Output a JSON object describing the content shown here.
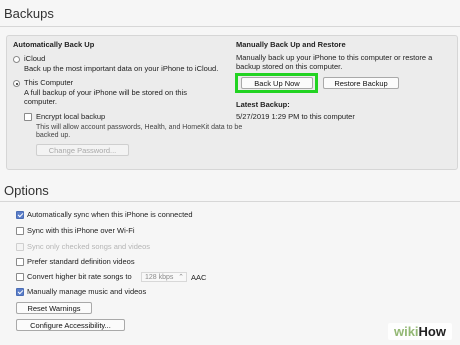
{
  "backups": {
    "title": "Backups",
    "auto": {
      "heading": "Automatically Back Up",
      "icloud_label": "iCloud",
      "icloud_desc": "Back up the most important data on your iPhone to iCloud.",
      "computer_label": "This Computer",
      "computer_desc_1": "A full backup of your iPhone will be stored on this",
      "computer_desc_2": "computer.",
      "encrypt_label": "Encrypt local backup",
      "encrypt_desc_1": "This will allow account passwords, Health, and HomeKit data to be",
      "encrypt_desc_2": "backed up.",
      "change_password": "Change Password..."
    },
    "manual": {
      "heading": "Manually Back Up and Restore",
      "desc_1": "Manually back up your iPhone to this computer or restore a",
      "desc_2": "backup stored on this computer.",
      "back_up_now": "Back Up Now",
      "restore_backup": "Restore Backup",
      "latest_heading": "Latest Backup:",
      "latest_value": "5/27/2019 1:29 PM to this computer"
    }
  },
  "options": {
    "title": "Options",
    "items": [
      {
        "label": "Automatically sync when this iPhone is connected",
        "checked": true,
        "disabled": false
      },
      {
        "label": "Sync with this iPhone over Wi-Fi",
        "checked": false,
        "disabled": false
      },
      {
        "label": "Sync only checked songs and videos",
        "checked": false,
        "disabled": true
      },
      {
        "label": "Prefer standard definition videos",
        "checked": false,
        "disabled": false
      },
      {
        "label": "Convert higher bit rate songs to",
        "checked": false,
        "disabled": false
      },
      {
        "label": "Manually manage music and videos",
        "checked": true,
        "disabled": false
      }
    ],
    "bitrate_value": "128 kbps",
    "bitrate_suffix": "AAC",
    "reset_warnings": "Reset Warnings",
    "configure_accessibility": "Configure Accessibility..."
  },
  "watermark": {
    "prefix": "wiki",
    "suffix": "How"
  },
  "colors": {
    "highlight": "#22d322",
    "accent": "#5b7ec9"
  }
}
